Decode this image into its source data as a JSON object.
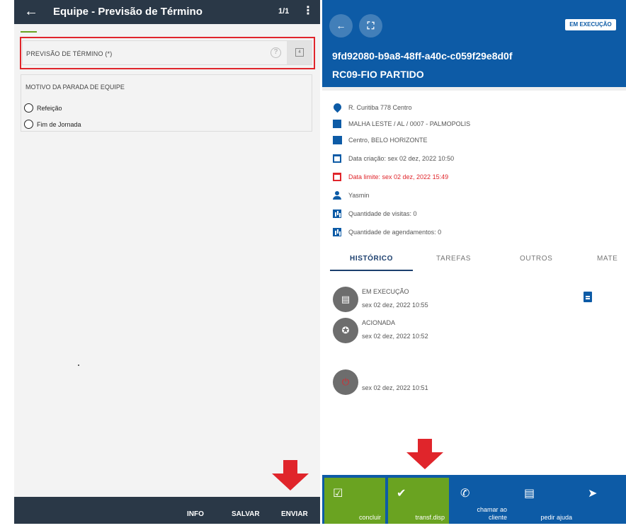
{
  "left": {
    "header": {
      "back_icon": "arrow-left-icon",
      "title": "Equipe - Previsão de Término",
      "page": "1/1",
      "more_icon": "more-vertical-icon"
    },
    "previsao": {
      "label": "PREVISÃO DE TÉRMINO (*)",
      "help_icon": "help-circle-icon",
      "calendar_icon": "calendar-icon"
    },
    "motivo": {
      "label": "MOTIVO DA PARADA DE EQUIPE",
      "options": [
        "Refeição",
        "Fim de Jornada"
      ]
    },
    "footer": {
      "info": "INFO",
      "salvar": "SALVAR",
      "enviar": "ENVIAR"
    }
  },
  "right": {
    "header": {
      "back_icon": "arrow-left-icon",
      "expand_icon": "fullscreen-icon",
      "status": "EM EXECUÇÃO",
      "id": "9fd92080-b9a8-48ff-a40c-c059f29e8d0f",
      "code": "RC09-FIO PARTIDO"
    },
    "info": [
      {
        "icon": "location-pin-icon",
        "text": "R. Curitiba 778 Centro"
      },
      {
        "icon": "map-icon",
        "text": "MALHA LESTE / AL / 0007 - PALMOPOLIS"
      },
      {
        "icon": "city-icon",
        "text": "Centro, BELO HORIZONTE"
      },
      {
        "icon": "calendar-icon",
        "text": "Data criação: sex 02 dez, 2022 10:50"
      },
      {
        "icon": "calendar-icon",
        "text": "Data limite: sex 02 dez, 2022 15:49"
      },
      {
        "icon": "person-icon",
        "text": "Yasmin"
      },
      {
        "icon": "bar-chart-icon",
        "text": "Quantidade de visitas: 0"
      },
      {
        "icon": "bar-chart-icon",
        "text": "Quantidade de agendamentos: 0"
      }
    ],
    "tabs": [
      "HISTÓRICO",
      "TAREFAS",
      "OUTROS",
      "MATE"
    ],
    "history": [
      {
        "icon": "clipboard-icon",
        "title": "EM EXECUÇÃO",
        "date": "sex 02 dez, 2022 10:55"
      },
      {
        "icon": "running-person-icon",
        "title": "ACIONADA",
        "date": "sex 02 dez, 2022 10:52"
      },
      {
        "icon": "power-icon",
        "title": "",
        "date": "sex 02 dez, 2022 10:51"
      }
    ],
    "doc_icon": "document-icon",
    "actions": [
      {
        "icon": "clipboard-check-icon",
        "label": "concluir"
      },
      {
        "icon": "transfer-icon",
        "label": "transf.disp"
      },
      {
        "icon": "phone-icon",
        "label_line1": "chamar ao",
        "label_line2": "cliente"
      },
      {
        "icon": "chat-icon",
        "label": "pedir ajuda"
      },
      {
        "icon": "directions-icon",
        "label": ""
      }
    ]
  },
  "colors": {
    "dark_header": "#2a3847",
    "blue": "#0d5ba6",
    "green": "#6aa321",
    "red": "#e0252b"
  }
}
